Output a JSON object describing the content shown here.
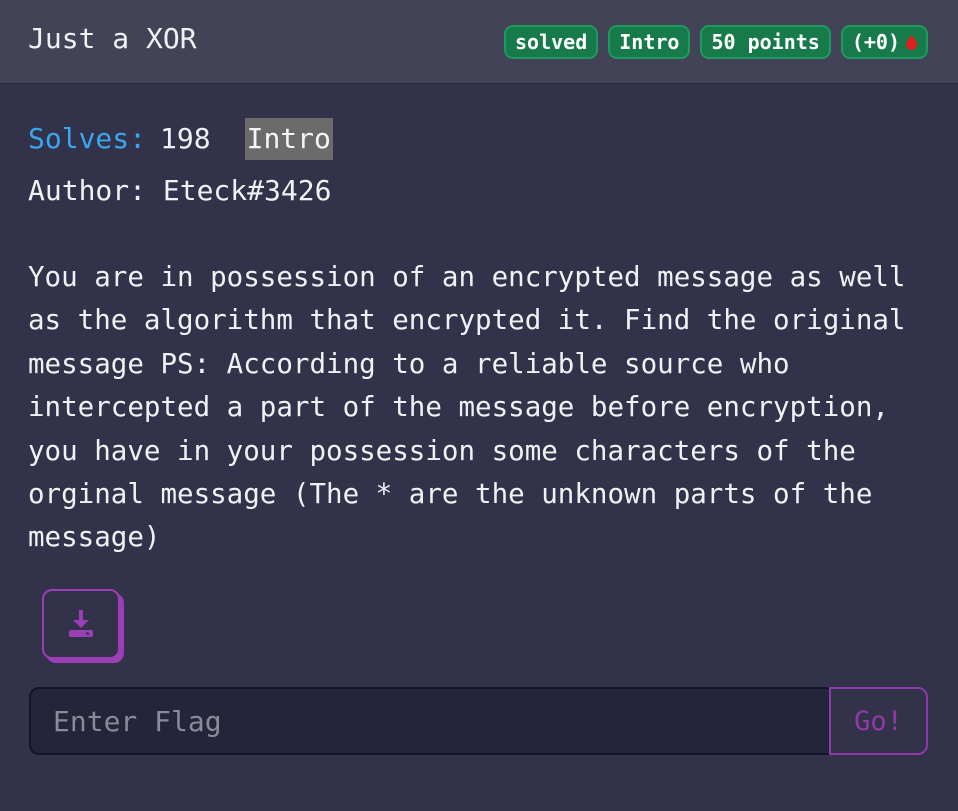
{
  "challenge": {
    "title": "Just a XOR",
    "badges": {
      "status": "solved",
      "category": "Intro",
      "points": "50 points",
      "bonus": "(+0)"
    },
    "solves_label": "Solves:",
    "solves_count": "198",
    "tag": "Intro",
    "author": "Author: Eteck#3426",
    "description": "You are in possession of an encrypted message as well as the algorithm that encrypted it. Find the original message PS: According to a reliable source who intercepted a part of the message before encryption, you have in your possession some characters of the orginal message (The * are the unknown parts of the message)"
  },
  "flag_form": {
    "placeholder": "Enter Flag",
    "submit_label": "Go!"
  },
  "icons": {
    "first_blood": "blood-drop-icon",
    "download": "download-icon"
  },
  "colors": {
    "badge_green": "#177a4b",
    "solves_blue": "#3aa6ee",
    "accent_purple": "#9b3fb5",
    "blood_red": "#e0201f"
  }
}
